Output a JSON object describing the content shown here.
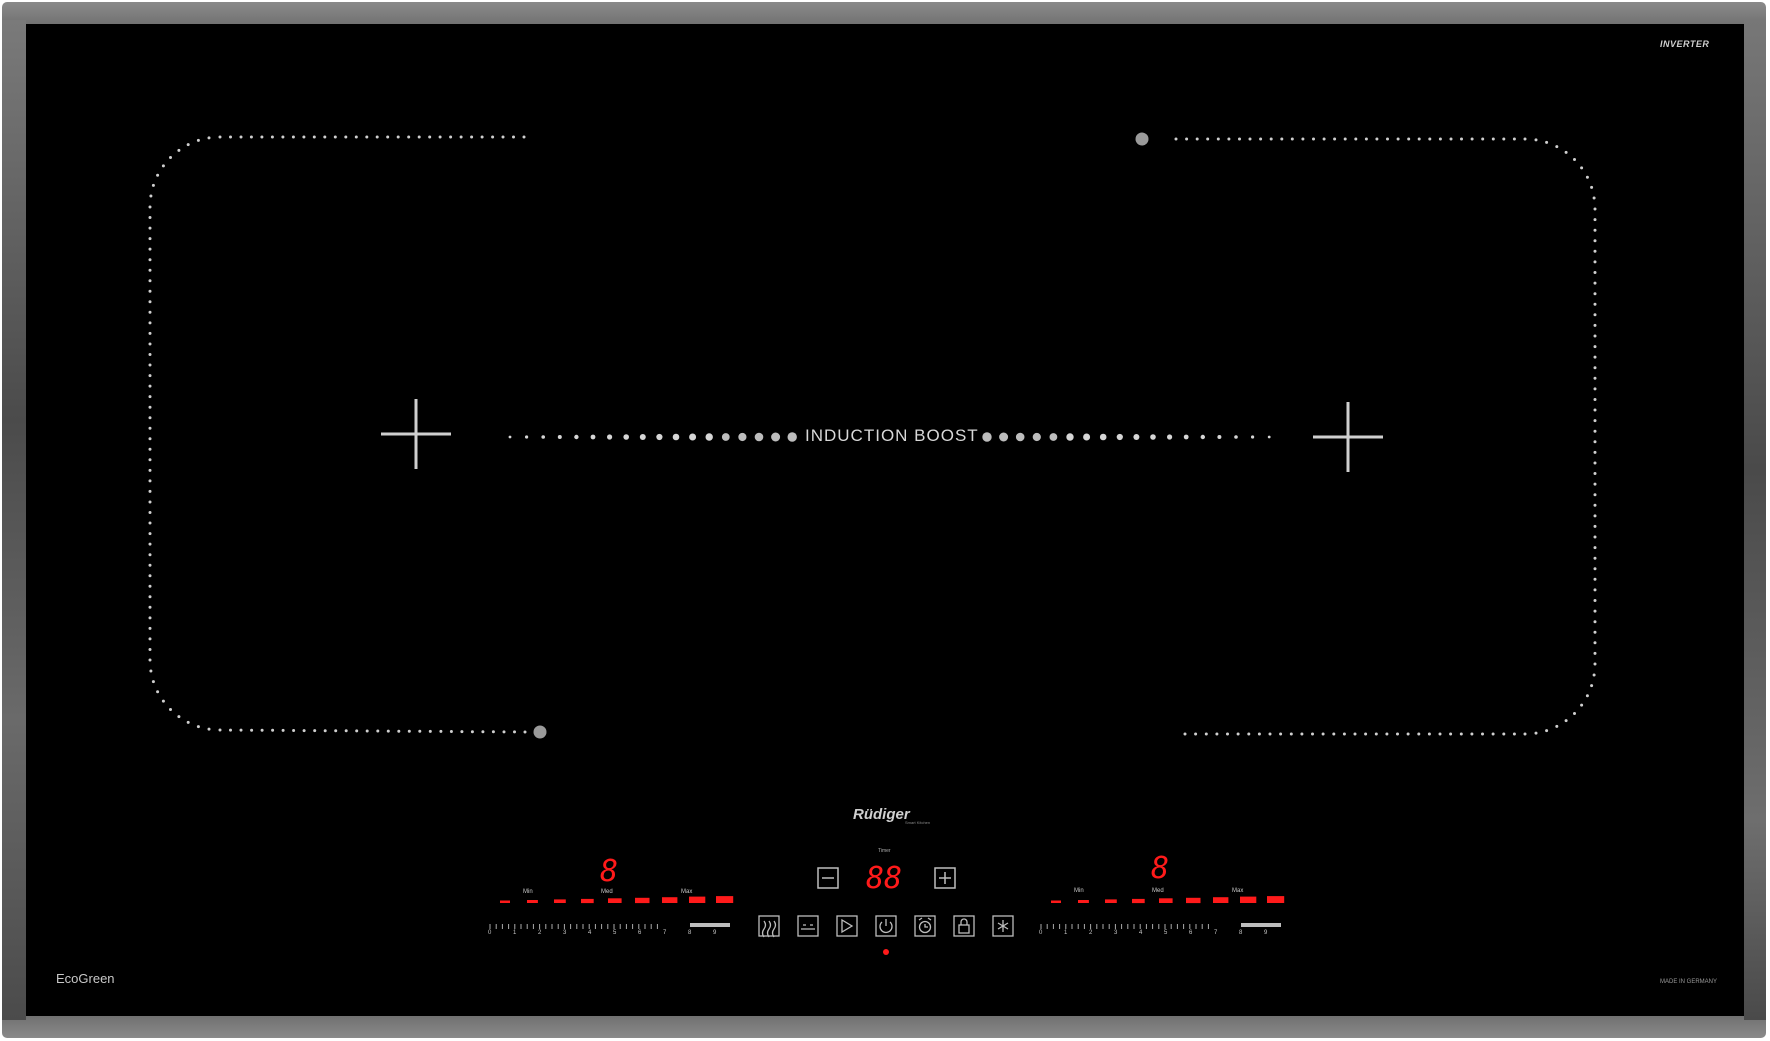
{
  "cooktop": {
    "brand_badge": "INVERTER",
    "boost_label": "INDUCTION BOOST",
    "brand_logo": "Rüdiger",
    "brand_sub": "Smart Kitchen",
    "eco_label": "EcoGreen",
    "made_label": "MADE IN GERMANY",
    "timer_label": "Timer",
    "timer_display": "88",
    "left_zone": {
      "display": "8",
      "scale_words": [
        "Min",
        "Med",
        "Max"
      ],
      "scale_numbers": [
        "0",
        "1",
        "2",
        "3",
        "4",
        "5",
        "6",
        "7",
        "8",
        "9"
      ]
    },
    "right_zone": {
      "display": "8",
      "scale_words": [
        "Min",
        "Med",
        "Max"
      ],
      "scale_numbers": [
        "0",
        "1",
        "2",
        "3",
        "4",
        "5",
        "6",
        "7",
        "8",
        "9"
      ]
    },
    "control_icons": [
      "warming-icon",
      "pause-icon",
      "boost-icon",
      "power-icon",
      "alarm-icon",
      "lock-icon",
      "defrost-icon"
    ],
    "colors": {
      "display_red": "#ff1a1a",
      "glass": "#000000",
      "print": "#c8c8c8"
    }
  }
}
